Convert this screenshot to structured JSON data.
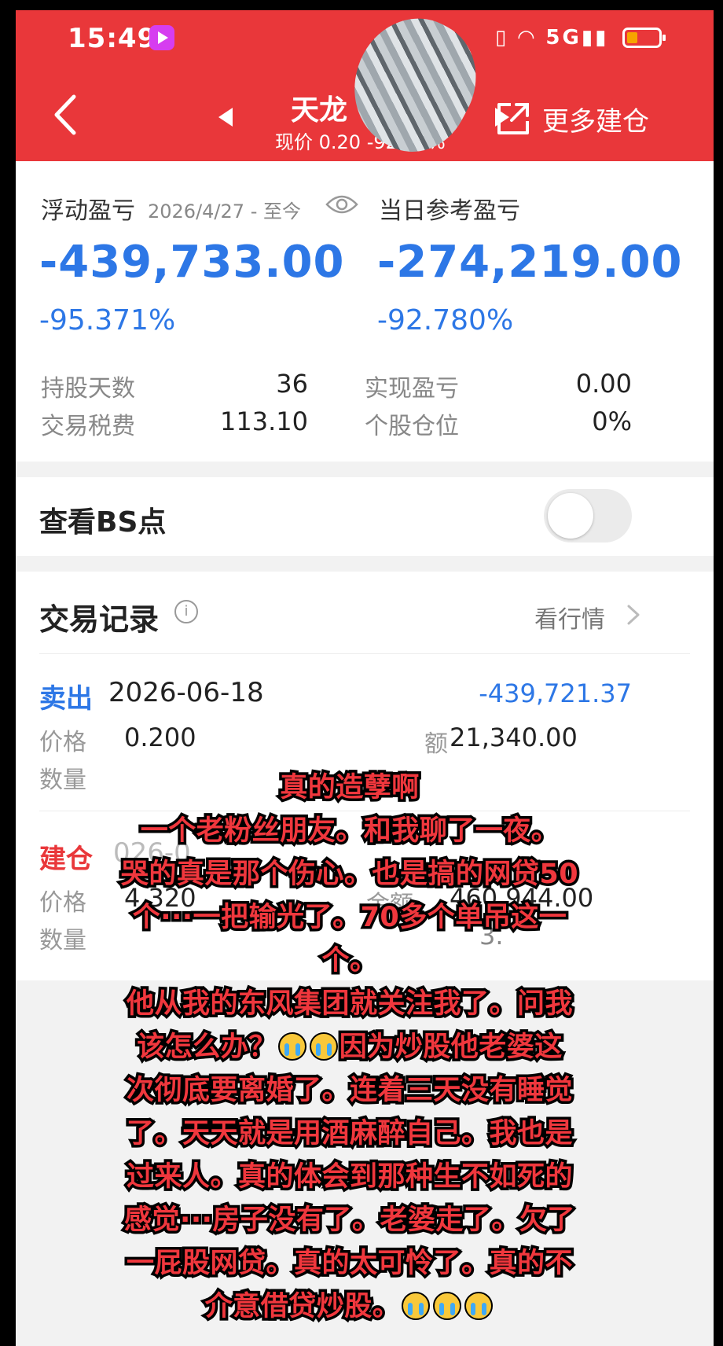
{
  "status_bar": {
    "time": "15:49",
    "icons": "5G"
  },
  "header": {
    "stock_name": "天龙",
    "sub": "现价 0.20 -92.78%",
    "more_label": "更多建仓"
  },
  "pnl": {
    "floating_label": "浮动盈亏",
    "date_range": "2026/4/27 - 至今",
    "floating_value": "-439,733.00",
    "floating_pct": "-95.371%",
    "daily_label": "当日参考盈亏",
    "daily_value": "-274,219.00",
    "daily_pct": "-92.780%",
    "stats": {
      "hold_days_label": "持股天数",
      "hold_days": "36",
      "realized_label": "实现盈亏",
      "realized": "0.00",
      "tax_label": "交易税费",
      "tax": "113.10",
      "position_label": "个股仓位",
      "position": "0%"
    }
  },
  "bs_toggle": {
    "label": "查看BS点",
    "on": false
  },
  "records": {
    "title": "交易记录",
    "view_market": "看行情",
    "items": [
      {
        "type": "卖出",
        "type_color": "#2d77e6",
        "date": "2026-06-18",
        "amount": "-439,721.37",
        "price_label": "价格",
        "price": "0.200",
        "amount_label_partial": "额",
        "total": "21,340.00",
        "qty_label": "数量"
      },
      {
        "type": "建仓",
        "type_color": "#e9373a",
        "date_partial": "026-0",
        "price_label": "价格",
        "price": "4.320",
        "amount_label": "金额",
        "total": "460,944.00",
        "qty_label": "数量",
        "qty_partial": "3."
      }
    ]
  },
  "caption": {
    "lines": [
      "真的造孽啊",
      "一个老粉丝朋友。和我聊了一夜。",
      "哭的真是那个伤心。也是搞的网贷50",
      "个···一把输光了。70多个单吊这一",
      "个。",
      "他从我的东风集团就关注我了。问我",
      "该怎么办？",
      "因为炒股他老婆这",
      "次彻底要离婚了。连着三天没有睡觉",
      "了。天天就是用酒麻醉自己。我也是",
      "过来人。真的体会到那种生不如死的",
      "感觉···房子没有了。老婆走了。欠了",
      "一屁股网贷。真的太可怜了。真的不",
      "介意借贷炒股。"
    ],
    "emoji": "loudly-crying-face"
  },
  "colors": {
    "brand_red": "#e9373a",
    "loss_blue": "#2d77e6"
  }
}
